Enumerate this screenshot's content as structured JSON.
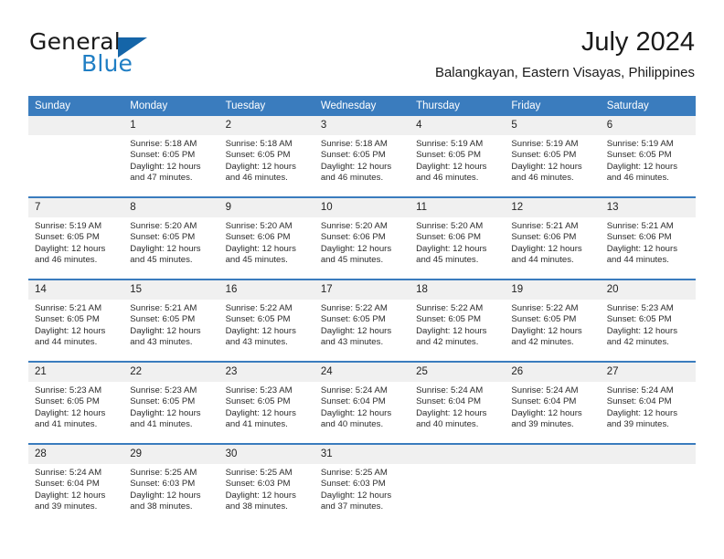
{
  "brand": {
    "name_top": "General",
    "name_bottom": "Blue",
    "accent_color": "#1f7ec4",
    "triangle_color": "#1565a8"
  },
  "header": {
    "title": "July 2024",
    "subtitle": "Balangkayan, Eastern Visayas, Philippines"
  },
  "theme": {
    "header_row_bg": "#3a7cbe",
    "daynum_bg": "#f0f0f0",
    "separator": "#3a7cbe"
  },
  "calendar": {
    "weekday_headers": [
      "Sunday",
      "Monday",
      "Tuesday",
      "Wednesday",
      "Thursday",
      "Friday",
      "Saturday"
    ],
    "weeks": [
      [
        {
          "day": "",
          "lines": []
        },
        {
          "day": "1",
          "lines": [
            "Sunrise: 5:18 AM",
            "Sunset: 6:05 PM",
            "Daylight: 12 hours",
            "and 47 minutes."
          ]
        },
        {
          "day": "2",
          "lines": [
            "Sunrise: 5:18 AM",
            "Sunset: 6:05 PM",
            "Daylight: 12 hours",
            "and 46 minutes."
          ]
        },
        {
          "day": "3",
          "lines": [
            "Sunrise: 5:18 AM",
            "Sunset: 6:05 PM",
            "Daylight: 12 hours",
            "and 46 minutes."
          ]
        },
        {
          "day": "4",
          "lines": [
            "Sunrise: 5:19 AM",
            "Sunset: 6:05 PM",
            "Daylight: 12 hours",
            "and 46 minutes."
          ]
        },
        {
          "day": "5",
          "lines": [
            "Sunrise: 5:19 AM",
            "Sunset: 6:05 PM",
            "Daylight: 12 hours",
            "and 46 minutes."
          ]
        },
        {
          "day": "6",
          "lines": [
            "Sunrise: 5:19 AM",
            "Sunset: 6:05 PM",
            "Daylight: 12 hours",
            "and 46 minutes."
          ]
        }
      ],
      [
        {
          "day": "7",
          "lines": [
            "Sunrise: 5:19 AM",
            "Sunset: 6:05 PM",
            "Daylight: 12 hours",
            "and 46 minutes."
          ]
        },
        {
          "day": "8",
          "lines": [
            "Sunrise: 5:20 AM",
            "Sunset: 6:05 PM",
            "Daylight: 12 hours",
            "and 45 minutes."
          ]
        },
        {
          "day": "9",
          "lines": [
            "Sunrise: 5:20 AM",
            "Sunset: 6:06 PM",
            "Daylight: 12 hours",
            "and 45 minutes."
          ]
        },
        {
          "day": "10",
          "lines": [
            "Sunrise: 5:20 AM",
            "Sunset: 6:06 PM",
            "Daylight: 12 hours",
            "and 45 minutes."
          ]
        },
        {
          "day": "11",
          "lines": [
            "Sunrise: 5:20 AM",
            "Sunset: 6:06 PM",
            "Daylight: 12 hours",
            "and 45 minutes."
          ]
        },
        {
          "day": "12",
          "lines": [
            "Sunrise: 5:21 AM",
            "Sunset: 6:06 PM",
            "Daylight: 12 hours",
            "and 44 minutes."
          ]
        },
        {
          "day": "13",
          "lines": [
            "Sunrise: 5:21 AM",
            "Sunset: 6:06 PM",
            "Daylight: 12 hours",
            "and 44 minutes."
          ]
        }
      ],
      [
        {
          "day": "14",
          "lines": [
            "Sunrise: 5:21 AM",
            "Sunset: 6:05 PM",
            "Daylight: 12 hours",
            "and 44 minutes."
          ]
        },
        {
          "day": "15",
          "lines": [
            "Sunrise: 5:21 AM",
            "Sunset: 6:05 PM",
            "Daylight: 12 hours",
            "and 43 minutes."
          ]
        },
        {
          "day": "16",
          "lines": [
            "Sunrise: 5:22 AM",
            "Sunset: 6:05 PM",
            "Daylight: 12 hours",
            "and 43 minutes."
          ]
        },
        {
          "day": "17",
          "lines": [
            "Sunrise: 5:22 AM",
            "Sunset: 6:05 PM",
            "Daylight: 12 hours",
            "and 43 minutes."
          ]
        },
        {
          "day": "18",
          "lines": [
            "Sunrise: 5:22 AM",
            "Sunset: 6:05 PM",
            "Daylight: 12 hours",
            "and 42 minutes."
          ]
        },
        {
          "day": "19",
          "lines": [
            "Sunrise: 5:22 AM",
            "Sunset: 6:05 PM",
            "Daylight: 12 hours",
            "and 42 minutes."
          ]
        },
        {
          "day": "20",
          "lines": [
            "Sunrise: 5:23 AM",
            "Sunset: 6:05 PM",
            "Daylight: 12 hours",
            "and 42 minutes."
          ]
        }
      ],
      [
        {
          "day": "21",
          "lines": [
            "Sunrise: 5:23 AM",
            "Sunset: 6:05 PM",
            "Daylight: 12 hours",
            "and 41 minutes."
          ]
        },
        {
          "day": "22",
          "lines": [
            "Sunrise: 5:23 AM",
            "Sunset: 6:05 PM",
            "Daylight: 12 hours",
            "and 41 minutes."
          ]
        },
        {
          "day": "23",
          "lines": [
            "Sunrise: 5:23 AM",
            "Sunset: 6:05 PM",
            "Daylight: 12 hours",
            "and 41 minutes."
          ]
        },
        {
          "day": "24",
          "lines": [
            "Sunrise: 5:24 AM",
            "Sunset: 6:04 PM",
            "Daylight: 12 hours",
            "and 40 minutes."
          ]
        },
        {
          "day": "25",
          "lines": [
            "Sunrise: 5:24 AM",
            "Sunset: 6:04 PM",
            "Daylight: 12 hours",
            "and 40 minutes."
          ]
        },
        {
          "day": "26",
          "lines": [
            "Sunrise: 5:24 AM",
            "Sunset: 6:04 PM",
            "Daylight: 12 hours",
            "and 39 minutes."
          ]
        },
        {
          "day": "27",
          "lines": [
            "Sunrise: 5:24 AM",
            "Sunset: 6:04 PM",
            "Daylight: 12 hours",
            "and 39 minutes."
          ]
        }
      ],
      [
        {
          "day": "28",
          "lines": [
            "Sunrise: 5:24 AM",
            "Sunset: 6:04 PM",
            "Daylight: 12 hours",
            "and 39 minutes."
          ]
        },
        {
          "day": "29",
          "lines": [
            "Sunrise: 5:25 AM",
            "Sunset: 6:03 PM",
            "Daylight: 12 hours",
            "and 38 minutes."
          ]
        },
        {
          "day": "30",
          "lines": [
            "Sunrise: 5:25 AM",
            "Sunset: 6:03 PM",
            "Daylight: 12 hours",
            "and 38 minutes."
          ]
        },
        {
          "day": "31",
          "lines": [
            "Sunrise: 5:25 AM",
            "Sunset: 6:03 PM",
            "Daylight: 12 hours",
            "and 37 minutes."
          ]
        },
        {
          "day": "",
          "lines": []
        },
        {
          "day": "",
          "lines": []
        },
        {
          "day": "",
          "lines": []
        }
      ]
    ]
  }
}
